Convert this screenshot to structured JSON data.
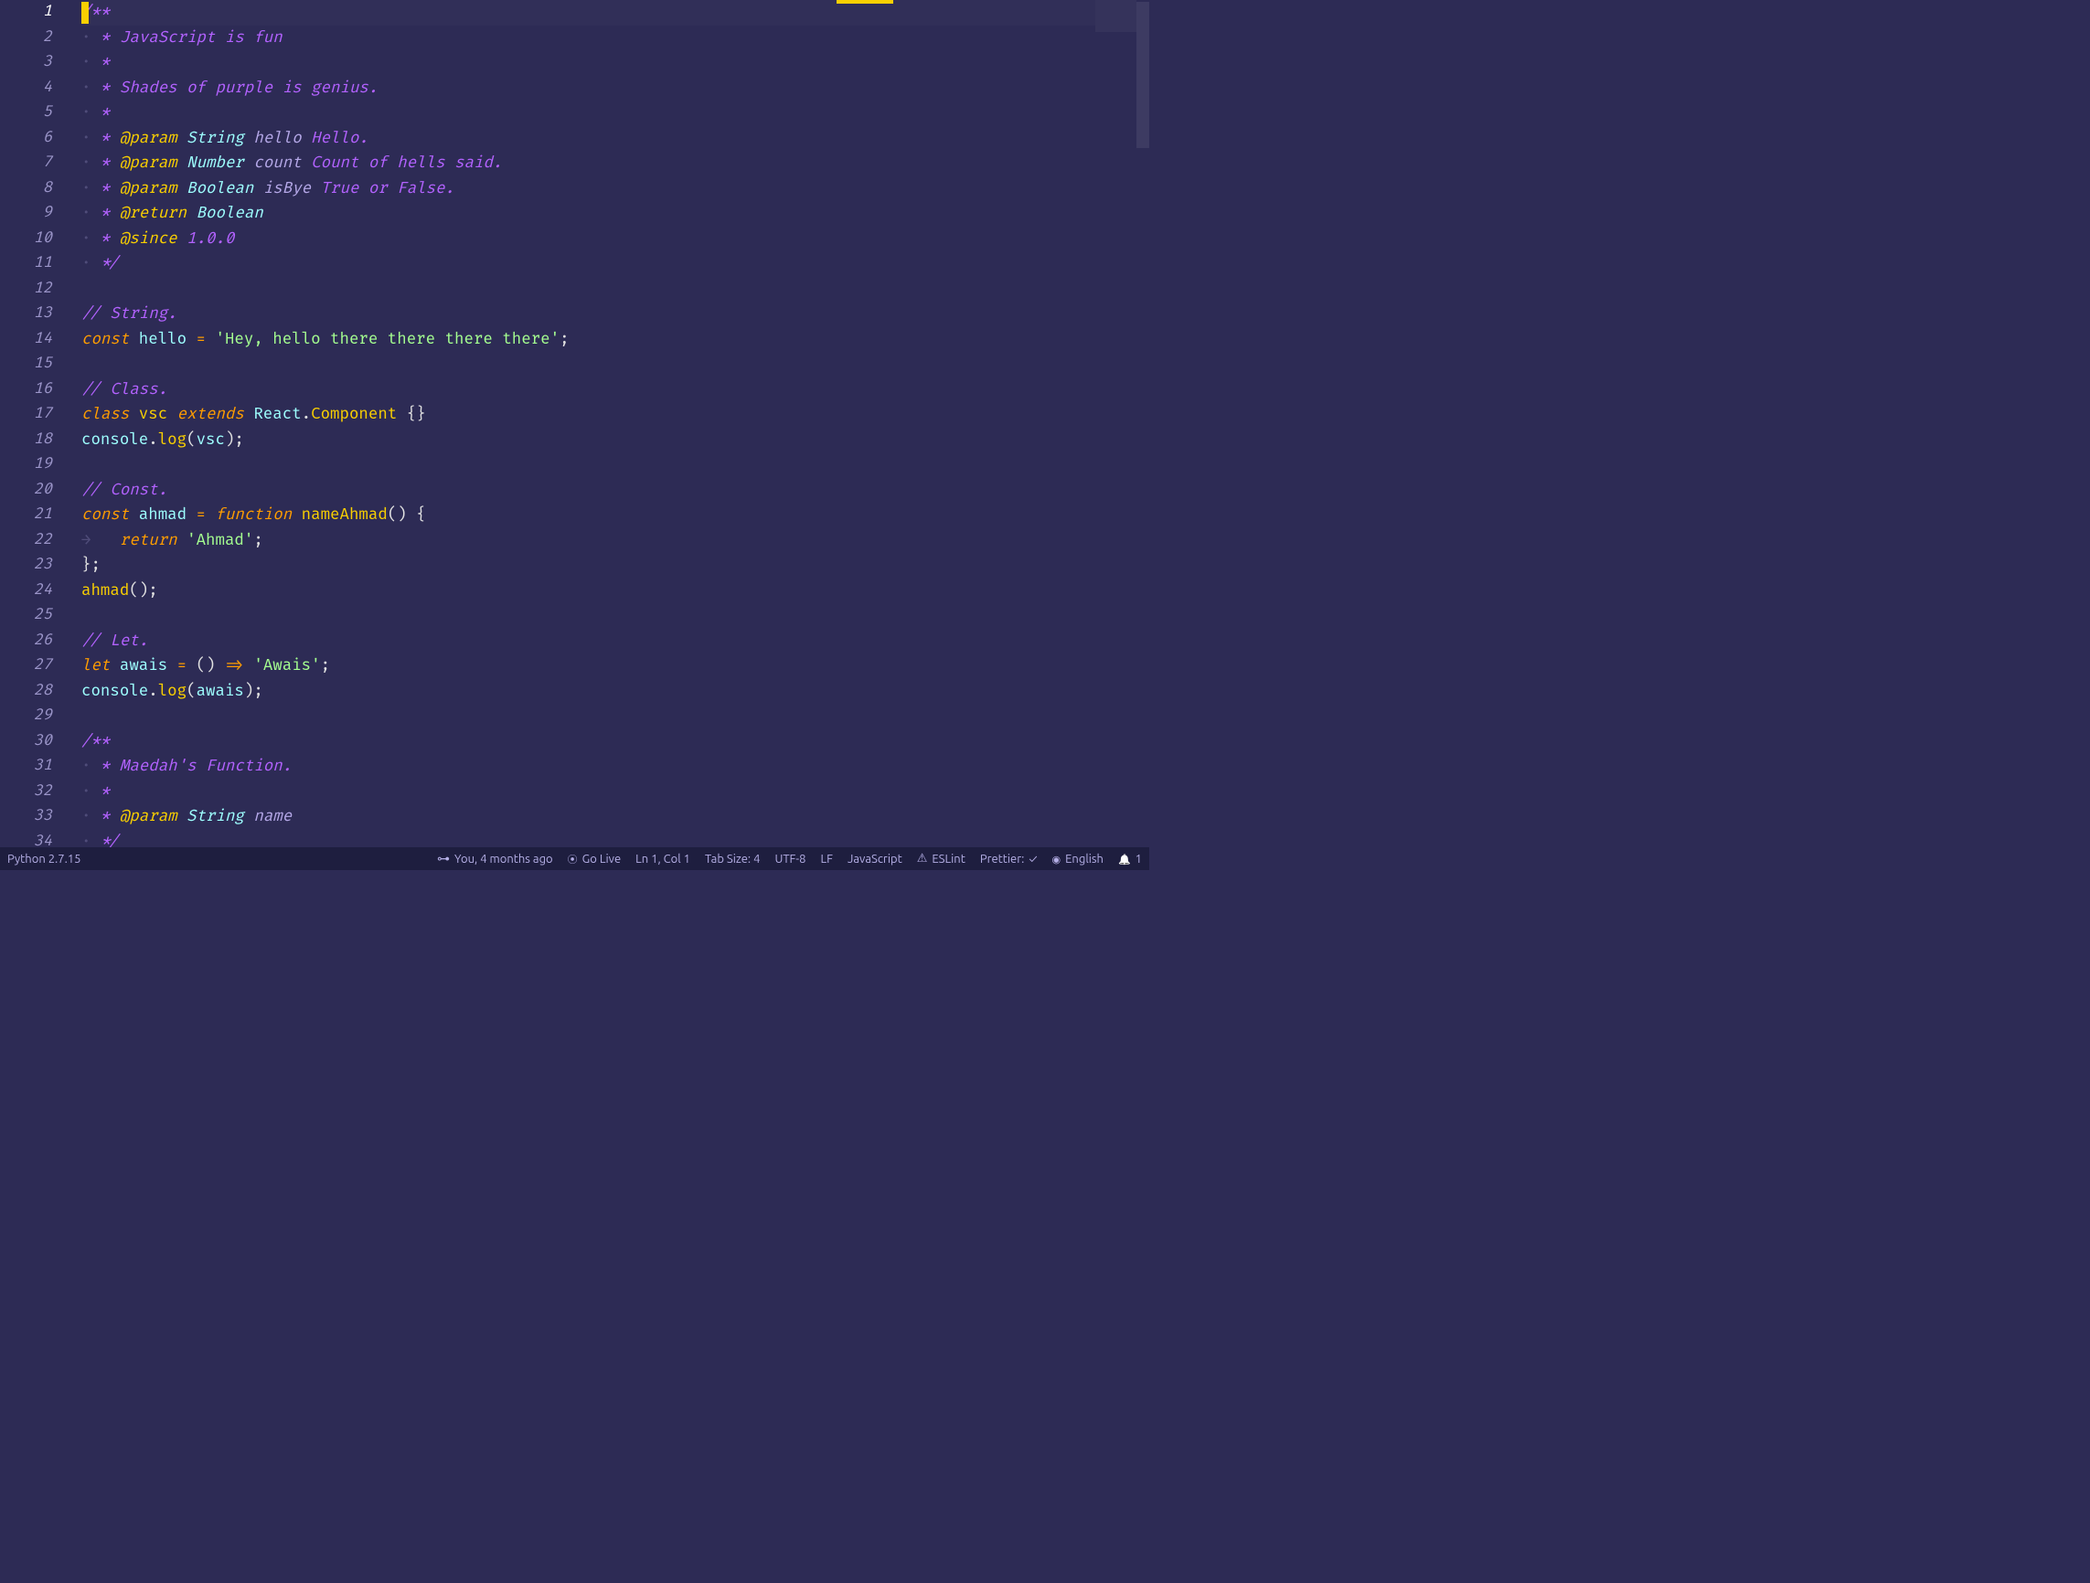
{
  "lines": {
    "count": 34
  },
  "code": {
    "l1": {
      "a": "/**"
    },
    "l2": {
      "a": " * ",
      "b": "JavaScript is fun"
    },
    "l3": {
      "a": " *"
    },
    "l4": {
      "a": " * ",
      "b": "Shades of purple is genius."
    },
    "l5": {
      "a": " *"
    },
    "l6": {
      "a": " * ",
      "tag": "@param",
      "type": "String",
      "name": "hello",
      "desc": "Hello."
    },
    "l7": {
      "a": " * ",
      "tag": "@param",
      "type": "Number",
      "name": "count",
      "desc": "Count of hells said."
    },
    "l8": {
      "a": " * ",
      "tag": "@param",
      "type": "Boolean",
      "name": "isBye",
      "desc": "True or False."
    },
    "l9": {
      "a": " * ",
      "tag": "@return",
      "type": "Boolean"
    },
    "l10": {
      "a": " * ",
      "tag": "@since",
      "ver": "1.0.0"
    },
    "l11": {
      "a": " */"
    },
    "l13": {
      "a": "// String."
    },
    "l14": {
      "kw": "const",
      "name": "hello",
      "eq": " = ",
      "str": "'Hey, hello there there there there'",
      "end": ";"
    },
    "l16": {
      "a": "// Class."
    },
    "l17": {
      "kw": "class",
      "cls": "vsc",
      "ext": "extends",
      "obj": "React",
      "dot": ".",
      "comp": "Component",
      "br": " {}"
    },
    "l18": {
      "obj": "console",
      "dot": ".",
      "method": "log",
      "open": "(",
      "arg": "vsc",
      "close": ")",
      "end": ";"
    },
    "l20": {
      "a": "// Const."
    },
    "l21": {
      "kw": "const",
      "name": "ahmad",
      "eq": " = ",
      "fn": "function",
      "fname": "nameAhmad",
      "paren": "()",
      "br": " {"
    },
    "l22": {
      "indent": "    ",
      "kw": "return",
      "str": "'Ahmad'",
      "end": ";"
    },
    "l23": {
      "br": "}",
      "end": ";"
    },
    "l24": {
      "name": "ahmad",
      "paren": "()",
      "end": ";"
    },
    "l26": {
      "a": "// Let."
    },
    "l27": {
      "kw": "let",
      "name": "awais",
      "eq": " = ",
      "paren": "()",
      "arrow": " => ",
      "str": "'Awais'",
      "end": ";"
    },
    "l28": {
      "obj": "console",
      "dot": ".",
      "method": "log",
      "open": "(",
      "arg": "awais",
      "close": ")",
      "end": ";"
    },
    "l30": {
      "a": "/**"
    },
    "l31": {
      "a": " * ",
      "b": "Maedah's Function."
    },
    "l32": {
      "a": " *"
    },
    "l33": {
      "a": " * ",
      "tag": "@param",
      "type": "String",
      "name": "name"
    },
    "l34": {
      "a": " */"
    }
  },
  "statusbar": {
    "python": "Python 2.7.15",
    "blame": "You, 4 months ago",
    "golive": "Go Live",
    "position": "Ln 1, Col 1",
    "tabsize": "Tab Size: 4",
    "encoding": "UTF-8",
    "eol": "LF",
    "language": "JavaScript",
    "eslint": "ESLint",
    "prettier": "Prettier: ",
    "spell": "English",
    "notifications": "1"
  }
}
